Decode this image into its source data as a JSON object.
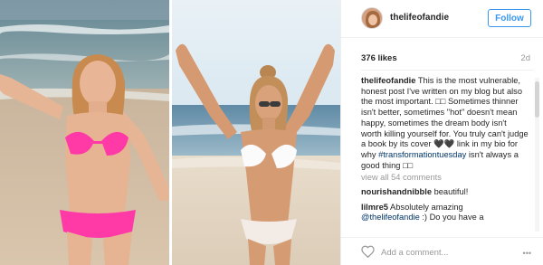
{
  "photo": {
    "panels": [
      "before-photo",
      "after-photo"
    ]
  },
  "header": {
    "username": "thelifeofandie",
    "follow_label": "Follow"
  },
  "stats": {
    "likes": "376 likes",
    "age": "2d"
  },
  "caption": {
    "username": "thelifeofandie",
    "text_before_hashtag": "This is the most vulnerable, honest post I've written on my blog but also the most important. □□ Sometimes thinner isn't better, sometimes \"hot\" doesn't mean happy, sometimes the dream body isn't worth killing yourself for. You truly can't judge a book by its cover 🖤🖤 link in my bio for why ",
    "hashtag": "#transformationtuesday",
    "text_after_hashtag": " isn't always a good thing □□"
  },
  "view_all": "view all 54 comments",
  "comments": [
    {
      "username": "nourishandnibble",
      "text": " beautiful!"
    },
    {
      "username": "lilmre5",
      "text": " Absolutely amazing"
    }
  ],
  "partial_comment": {
    "mention": "@thelifeofandie",
    "text": " :) Do you have a"
  },
  "footer": {
    "comment_placeholder": "Add a comment...",
    "more_label": "•••"
  },
  "colors": {
    "accent": "#3897f0",
    "hashtag": "#003569",
    "muted": "#999999",
    "bikini_pink": "#ff3aa6"
  }
}
